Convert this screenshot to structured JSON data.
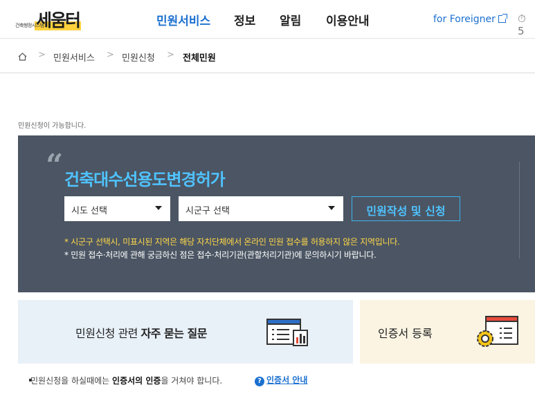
{
  "header": {
    "logo_main": "세움터",
    "logo_sub": "건축행정시스템",
    "nav": [
      "민원서비스",
      "정보",
      "알림",
      "이용안내"
    ],
    "foreigner": "for Foreigner",
    "clock_glyph": "⏱ 5"
  },
  "breadcrumb": {
    "items": [
      "민원서비스",
      "민원신청",
      "전체민원"
    ]
  },
  "availability": "민원신청이 가능합니다.",
  "panel": {
    "title": "건축대수선용도변경허가",
    "sido_select": "시도 선택",
    "sigungu_select": "시군구 선택",
    "apply_button": "민원작성 및 신청",
    "notice_yellow": "* 시군구 선택시, 미표시된 지역은 해당 자치단체에서 온라인 민원 접수를 허용하지 않은 지역입니다.",
    "notice_white": "* 민원 접수·처리에 관해 궁금하신 점은 접수·처리기관(관할처리기관)에 문의하시기 바랍니다."
  },
  "cards": {
    "faq_prefix": "민원신청 관련 ",
    "faq_bold": "자주 묻는 질문",
    "cert": "인증서 등록"
  },
  "bottom": {
    "note_prefix": "민원신청을 하실때에는 ",
    "note_bold": "인증서의 인증",
    "note_suffix": "을 거쳐야 합니다.",
    "help_link": "인증서 안내"
  },
  "colors": {
    "accent": "#1a6fcf",
    "panel_bg": "#4b5563",
    "panel_title": "#4fc3ff",
    "notice_yellow": "#ffd84a"
  }
}
